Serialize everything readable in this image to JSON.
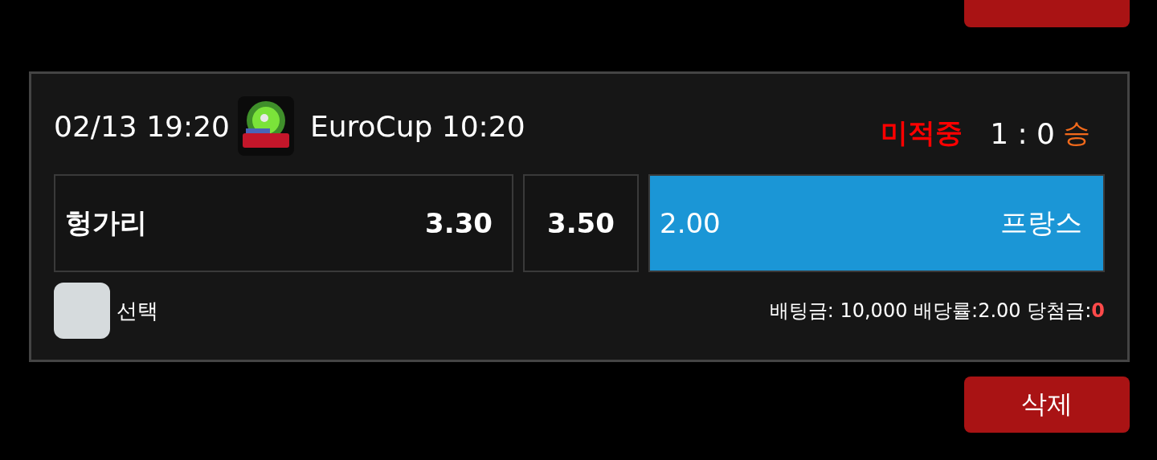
{
  "bet": {
    "date": "02/13 19:20",
    "league": "EuroCup 10:20",
    "result": "미적중",
    "score": "1 : 0",
    "outcome": "승",
    "odds": [
      {
        "kind": "home",
        "team": "헝가리",
        "odds": "3.30",
        "selected": false
      },
      {
        "kind": "draw",
        "odds": "3.50",
        "selected": false
      },
      {
        "kind": "away",
        "team": "프랑스",
        "odds": "2.00",
        "selected": true
      }
    ],
    "select": {
      "label": "선택",
      "checked": false
    },
    "summary": {
      "text": "배팅금: 10,000 배당률:2.00 당첨금:",
      "winnings": "0"
    }
  },
  "delete_button": {
    "label": "삭제"
  }
}
